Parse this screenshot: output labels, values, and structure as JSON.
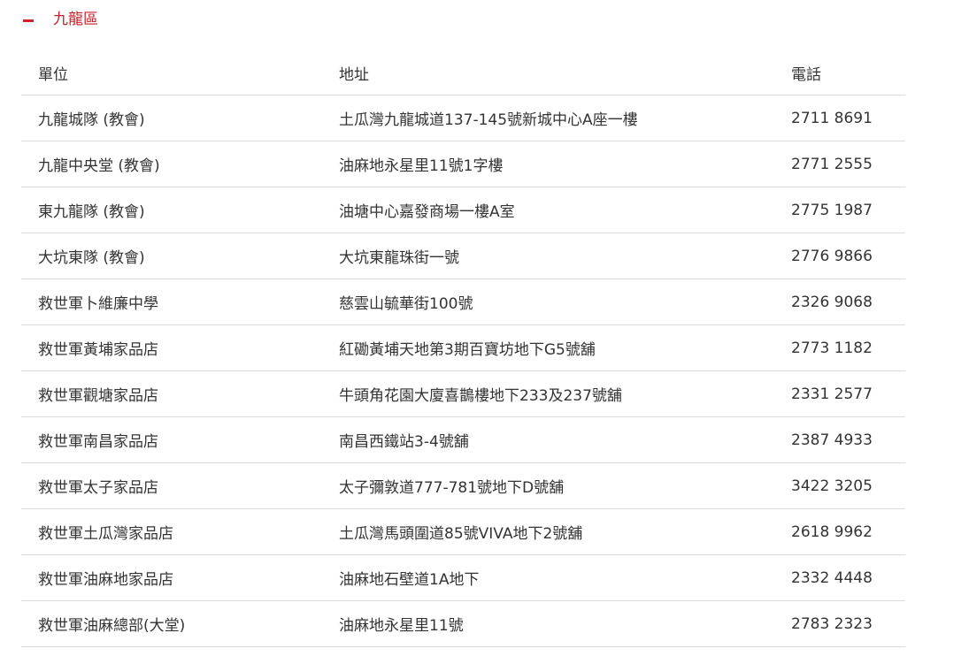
{
  "section": {
    "title": "九龍區"
  },
  "table": {
    "headers": {
      "unit": "單位",
      "address": "地址",
      "phone": "電話"
    },
    "rows": [
      {
        "unit": "九龍城隊 (教會)",
        "address": "土瓜灣九龍城道137-145號新城中心A座一樓",
        "phone": "2711 8691"
      },
      {
        "unit": "九龍中央堂 (教會)",
        "address": "油麻地永星里11號1字樓",
        "phone": "2771 2555"
      },
      {
        "unit": "東九龍隊  (教會)",
        "address": "油塘中心嘉發商場一樓A室",
        "phone": "2775 1987"
      },
      {
        "unit": "大坑東隊 (教會)",
        "address": "大坑東龍珠街一號",
        "phone": "2776 9866"
      },
      {
        "unit": "救世軍卜維廉中學",
        "address": "慈雲山毓華街100號",
        "phone": "2326 9068"
      },
      {
        "unit": "救世軍黃埔家品店",
        "address": "紅磡黃埔天地第3期百寶坊地下G5號舖",
        "phone": "2773 1182"
      },
      {
        "unit": "救世軍觀塘家品店",
        "address": "牛頭角花園大廈喜鵲樓地下233及237號舖",
        "phone": "2331 2577"
      },
      {
        "unit": "救世軍南昌家品店",
        "address": "南昌西鐵站3-4號舖",
        "phone": "2387 4933"
      },
      {
        "unit": "救世軍太子家品店",
        "address": "太子彌敦道777-781號地下D號舖",
        "phone": "3422 3205"
      },
      {
        "unit": "救世軍土瓜灣家品店",
        "address": "土瓜灣馬頭圍道85號VIVA地下2號舖",
        "phone": "2618 9962"
      },
      {
        "unit": "救世軍油麻地家品店",
        "address": "油麻地石壁道1A地下",
        "phone": "2332 4448"
      },
      {
        "unit": "救世軍油麻總部(大堂)",
        "address": "油麻地永星里11號",
        "phone": "2783 2323"
      }
    ]
  },
  "colors": {
    "accent": "#c8202a",
    "text": "#333333",
    "divider": "#dcdcdc"
  },
  "icons": {
    "toggle": "minus-icon"
  }
}
